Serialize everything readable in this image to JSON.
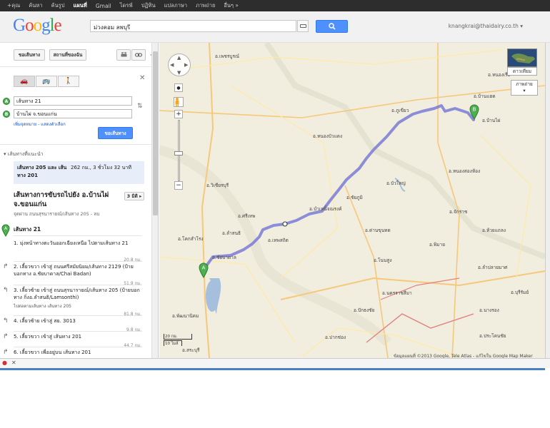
{
  "topbar": {
    "items": [
      "+คุณ",
      "ค้นหา",
      "ค้นรูป",
      "แผนที่",
      "Gmail",
      "ไดรฟ์",
      "ปฏิทิน",
      "แปลภาษา",
      "ภาพถ่าย",
      "อื่นๆ »"
    ],
    "active_index": 3
  },
  "header": {
    "logo": "Google",
    "search_value": "ม่วงคอม ลพบุรี",
    "account": "knangkrai@thaidairy.co.th ▾"
  },
  "sidebar": {
    "directions_button": "ขอเส้นทาง",
    "my_places_button": "สถานที่ของฉัน",
    "origin": "เส้นทาง 21",
    "destination": "บ้านไผ่ จ.ขอนแก่น",
    "add_destination": "เพิ่มจุดหมาย - แสดงตัวเลือก",
    "get_directions": "ขอเส้นทาง",
    "suggested_routes_label": "เส้นทางที่แนะนำ",
    "route_summary": "เส้นทาง 205 และ เส้นทาง 201",
    "route_distance": "262 กม., 3 ชั่วโมง 32 นาที",
    "driving_title": "เส้นทางการขับรถไปยัง อ.บ้านไผ่ จ.ขอนแก่น",
    "driving_subtitle": "จุดผ่าน ถนนสุรนารายณ์/เส้นทาง 205 - ลบ",
    "view_button": "3 มิติ ▸",
    "start_label": "เส้นทาง 21",
    "steps": [
      {
        "text": "1. มุ่งหน้าทางตะวันออกเฉียงเหนือ ไปตามเส้นทาง 21",
        "dist": "20.8 กม."
      },
      {
        "text": "2. เลี้ยวขวา เข้าสู่ ถนนศรีสมัยนิยม/เส้นทาง 2129 (ป้ายบอกทาง อ.ชัยบาดาล/Chai Badan)",
        "dist": "51.9 กม."
      },
      {
        "text": "3. เลี้ยวซ้าย เข้าสู่ ถนนสุรนารายณ์/เส้นทาง 205 (ป้ายบอกทาง กิ่งอ.ลำสนธิ/Lamsonthi)",
        "dist": "81.8 กม.",
        "note": "ไปต่อตามเส้นทาง เส้นทาง 205"
      },
      {
        "text": "4. เลี้ยวซ้าย เข้าสู่ สย. 3013",
        "dist": "9.8 กม."
      },
      {
        "text": "5. เลี้ยวขวา เข้าสู่ เส้นทาง 201",
        "dist": "44.7 กม."
      },
      {
        "text": "6. เลี้ยวขวา เพื่ออยู่บน เส้นทาง 201",
        "dist": ""
      }
    ]
  },
  "map": {
    "places": [
      {
        "name": "อ.เพชรบูรณ์"
      },
      {
        "name": "อ.บ้านแฮด"
      },
      {
        "name": "อ.หนองเรือ"
      },
      {
        "name": "อ.หนองบัวแดง"
      },
      {
        "name": "อ.ภูเขียว"
      },
      {
        "name": "อ.บ้านไผ่"
      },
      {
        "name": "อ.หนองสองห้อง"
      },
      {
        "name": "อ.ชัยภูมิ"
      },
      {
        "name": "อ.บำเหน็จณรงค์"
      },
      {
        "name": "อ.ด่านขุนทด"
      },
      {
        "name": "อ.วิเชียรบุรี"
      },
      {
        "name": "อ.ลำสนธิ"
      },
      {
        "name": "อ.ชัยบาดาล"
      },
      {
        "name": "อ.พัฒนานิคม"
      },
      {
        "name": "อ.ปากช่อง"
      },
      {
        "name": "อ.โนนสูง"
      },
      {
        "name": "อ.บัวใหญ่"
      },
      {
        "name": "อ.พิมาย"
      },
      {
        "name": "อ.จักราช"
      },
      {
        "name": "อ.ห้วยแถลง"
      },
      {
        "name": "อ.ลำปลายมาศ"
      },
      {
        "name": "อ.นครราชสีมา"
      },
      {
        "name": "อ.โคกสำโรง"
      },
      {
        "name": "อ.ปักธงชัย"
      },
      {
        "name": "อ.บุรีรัมย์"
      },
      {
        "name": "อ.ประโคนชัย"
      },
      {
        "name": "อ.นางรอง"
      },
      {
        "name": "อ.สระบุรี"
      },
      {
        "name": "อ.เทพสถิต"
      },
      {
        "name": "อ.ศรีเทพ"
      }
    ],
    "map_type_satellite": "ดาวเทียม",
    "map_type_photos": "ภาพถ่าย",
    "scale_km": "20 กม.",
    "scale_mi": "10 ไมล์",
    "copyright": "ข้อมูลแผนที่ ©2013 Google, Tele Atlas - แก้ไขใน Google Map Maker"
  },
  "colors": {
    "route": "#7a7ad6",
    "marker": "#4caf50",
    "search_button": "#4d90fe"
  }
}
